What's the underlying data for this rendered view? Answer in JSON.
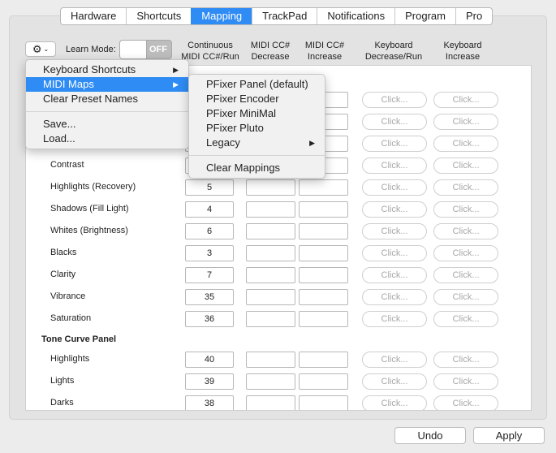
{
  "tabs": [
    {
      "label": "Hardware"
    },
    {
      "label": "Shortcuts"
    },
    {
      "label": "Mapping",
      "active": true
    },
    {
      "label": "TrackPad"
    },
    {
      "label": "Notifications"
    },
    {
      "label": "Program"
    },
    {
      "label": "Pro"
    }
  ],
  "toolbar": {
    "learn_mode_label": "Learn Mode:",
    "learn_mode_state": "OFF",
    "gear_glyph": "⚙",
    "chevron_glyph": "⌄"
  },
  "columns": {
    "continuous": [
      "Continuous",
      "MIDI CC#/Run"
    ],
    "decrease": [
      "MIDI CC#",
      "Decrease"
    ],
    "increase": [
      "MIDI CC#",
      "Increase"
    ],
    "kbd_decrease": [
      "Keyboard",
      "Decrease/Run"
    ],
    "kbd_increase": [
      "Keyboard",
      "Increase"
    ]
  },
  "click_label": "Click...",
  "rows": [
    {
      "label": "",
      "cc": ""
    },
    {
      "label": "",
      "cc": ""
    },
    {
      "label": "",
      "cc": ""
    },
    {
      "label": "Contrast",
      "cc": ""
    },
    {
      "label": "Highlights (Recovery)",
      "cc": "5"
    },
    {
      "label": "Shadows (Fill Light)",
      "cc": "4"
    },
    {
      "label": "Whites (Brightness)",
      "cc": "6"
    },
    {
      "label": "Blacks",
      "cc": "3"
    },
    {
      "label": "Clarity",
      "cc": "7"
    },
    {
      "label": "Vibrance",
      "cc": "35"
    },
    {
      "label": "Saturation",
      "cc": "36"
    }
  ],
  "section2": {
    "title": "Tone Curve Panel",
    "rows": [
      {
        "label": "Highlights",
        "cc": "40"
      },
      {
        "label": "Lights",
        "cc": "39"
      },
      {
        "label": "Darks",
        "cc": "38"
      }
    ]
  },
  "main_menu": {
    "items": [
      {
        "label": "Keyboard Shortcuts",
        "submenu": true
      },
      {
        "label": "MIDI Maps",
        "submenu": true,
        "highlighted": true
      },
      {
        "label": "Clear Preset Names"
      },
      {
        "label": "Save..."
      },
      {
        "label": "Load..."
      }
    ]
  },
  "sub_menu": {
    "items": [
      {
        "label": "PFixer Panel (default)"
      },
      {
        "label": "PFixer Encoder"
      },
      {
        "label": "PFixer MiniMal"
      },
      {
        "label": "PFixer Pluto"
      },
      {
        "label": "Legacy",
        "submenu": true
      },
      {
        "label": "Clear Mappings"
      }
    ]
  },
  "buttons": {
    "undo": "Undo",
    "apply": "Apply"
  },
  "colors": {
    "accent": "#2f8cf4",
    "toggle_off": "#bdbdbd"
  }
}
